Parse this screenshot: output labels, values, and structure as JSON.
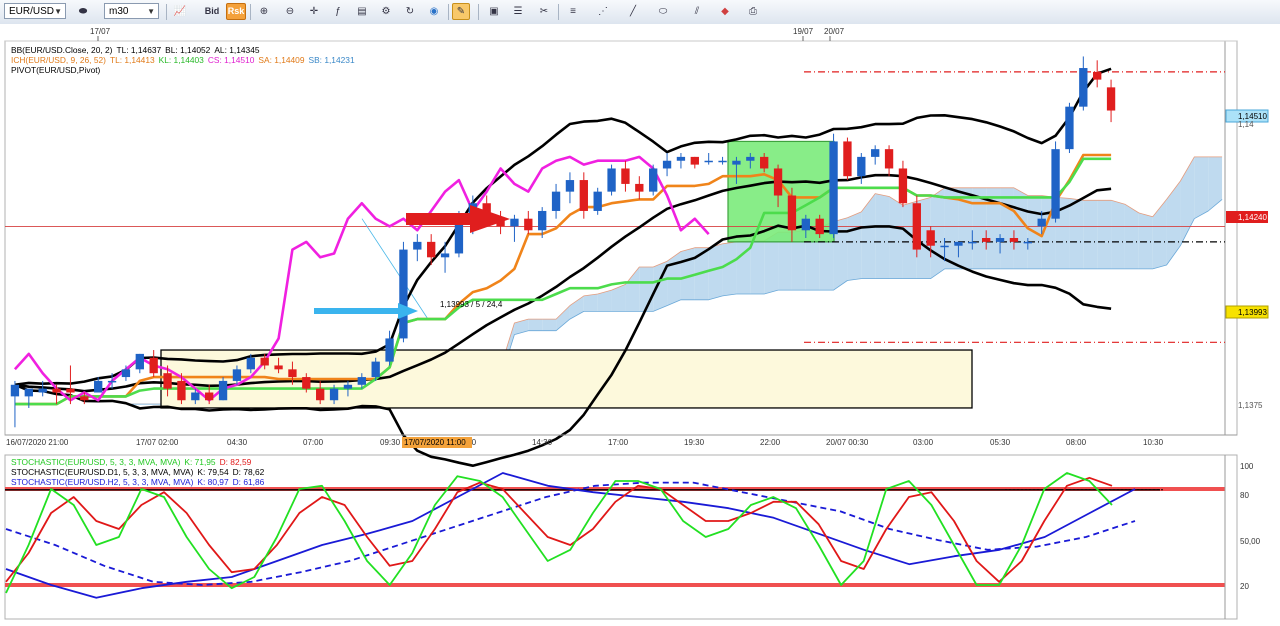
{
  "toolbar": {
    "symbol": "EUR/USD",
    "timeframe": "m30",
    "bid_label": "Bid",
    "risk_label": "Rsk",
    "icons": [
      "chart-type-icon",
      "zoom-in-icon",
      "zoom-out-icon",
      "crosshair-icon",
      "indicators-icon",
      "templates-icon",
      "settings-icon",
      "globe-icon",
      "pencil-tool-icon",
      "image-icon",
      "properties-icon",
      "fibonacci-icon",
      "lines-menu-icon",
      "trend-tools-icon",
      "line-icon",
      "shapes-icon",
      "channels-icon",
      "eraser-icon",
      "print-icon"
    ]
  },
  "colors": {
    "bull": "#1f63c6",
    "bear": "#e01e1e",
    "bb": "#000000",
    "tenkan": "#f0841a",
    "kijun": "#4cdc4c",
    "chikou": "#f020e0",
    "kumo_a": "#f0c8b4",
    "kumo_b": "#b4d4ec",
    "stoch_k": "#22e022",
    "stoch_d": "#e01818",
    "stoch_h2": "#1a1ad6",
    "level": "#f05050"
  },
  "top_dates": [
    "17/07",
    "19/07",
    "20/07"
  ],
  "legends": {
    "bb": {
      "name": "BB(EUR/USD.Close, 20, 2)",
      "tl": "TL: 1,14637",
      "bl": "BL: 1,14052",
      "al": "AL: 1,14345"
    },
    "ich": {
      "name": "ICH(EUR/USD, 9, 26, 52)",
      "tl": "TL: 1,14413",
      "kl": "KL: 1,14403",
      "cs": "CS: 1,14510",
      "sa": "SA: 1,14409",
      "sb": "SB: 1,14231"
    },
    "pivot": "PIVOT(EUR/USD,Pivot)"
  },
  "price_labels": {
    "last": "1,14510",
    "pivot_level": "1,14240",
    "marker": "1,13993",
    "tick_upper": "1,14",
    "tick_lower": "1,1375"
  },
  "annotation": "1,13993 / 5 / 24,4",
  "time_axis": [
    "16/07/2020 21:00",
    "17/07 02:00",
    "04:30",
    "07:00",
    "09:30",
    "12:00",
    "14:30",
    "17:00",
    "19:30",
    "22:00",
    "20/07 00:30",
    "03:00",
    "05:30",
    "08:00",
    "10:30"
  ],
  "crosshair_time": "17/07/2020 11:00",
  "stoch_legends": {
    "m30": {
      "name": "STOCHASTIC(EUR/USD, 5, 3, 3, MVA, MVA)",
      "k": "K: 71,95",
      "d": "D: 82,59"
    },
    "d1": {
      "name": "STOCHASTIC(EUR/USD.D1, 5, 3, 3, MVA, MVA)",
      "k": "K: 79,54",
      "d": "D: 78,62"
    },
    "h2": {
      "name": "STOCHASTIC(EUR/USD.H2, 5, 3, 3, MVA, MVA)",
      "k": "K: 80,97",
      "d": "D: 61,86"
    }
  },
  "stoch_axis": [
    "100",
    "80",
    "50,00",
    "20"
  ],
  "chart_data": {
    "type": "candlestick",
    "symbol": "EUR/USD",
    "timeframe": "m30",
    "ylim": [
      1.137,
      1.1472
    ],
    "candles": [
      {
        "o": 1.138,
        "h": 1.1384,
        "l": 1.1372,
        "c": 1.1383
      },
      {
        "o": 1.138,
        "h": 1.1382,
        "l": 1.1377,
        "c": 1.1382
      },
      {
        "o": 1.1381,
        "h": 1.1384,
        "l": 1.138,
        "c": 1.1382
      },
      {
        "o": 1.1382,
        "h": 1.1383,
        "l": 1.1378,
        "c": 1.1381
      },
      {
        "o": 1.1382,
        "h": 1.1388,
        "l": 1.1378,
        "c": 1.1381
      },
      {
        "o": 1.138,
        "h": 1.1381,
        "l": 1.1378,
        "c": 1.1379
      },
      {
        "o": 1.1381,
        "h": 1.1385,
        "l": 1.1381,
        "c": 1.1384
      },
      {
        "o": 1.1384,
        "h": 1.1386,
        "l": 1.1382,
        "c": 1.1384
      },
      {
        "o": 1.1385,
        "h": 1.1388,
        "l": 1.1384,
        "c": 1.1387
      },
      {
        "o": 1.1387,
        "h": 1.1391,
        "l": 1.1386,
        "c": 1.1391
      },
      {
        "o": 1.139,
        "h": 1.1392,
        "l": 1.1385,
        "c": 1.1386
      },
      {
        "o": 1.1386,
        "h": 1.1388,
        "l": 1.138,
        "c": 1.1382
      },
      {
        "o": 1.1384,
        "h": 1.1386,
        "l": 1.1378,
        "c": 1.1379
      },
      {
        "o": 1.1379,
        "h": 1.1382,
        "l": 1.1378,
        "c": 1.1381
      },
      {
        "o": 1.1381,
        "h": 1.1383,
        "l": 1.1378,
        "c": 1.1379
      },
      {
        "o": 1.1379,
        "h": 1.1385,
        "l": 1.1379,
        "c": 1.1384
      },
      {
        "o": 1.1384,
        "h": 1.1388,
        "l": 1.1383,
        "c": 1.1387
      },
      {
        "o": 1.1387,
        "h": 1.1391,
        "l": 1.1386,
        "c": 1.139
      },
      {
        "o": 1.139,
        "h": 1.1391,
        "l": 1.1387,
        "c": 1.1388
      },
      {
        "o": 1.1388,
        "h": 1.139,
        "l": 1.1386,
        "c": 1.1387
      },
      {
        "o": 1.1387,
        "h": 1.1389,
        "l": 1.1383,
        "c": 1.1385
      },
      {
        "o": 1.1385,
        "h": 1.1386,
        "l": 1.1381,
        "c": 1.1382
      },
      {
        "o": 1.1382,
        "h": 1.1384,
        "l": 1.1378,
        "c": 1.1379
      },
      {
        "o": 1.1379,
        "h": 1.1383,
        "l": 1.1378,
        "c": 1.1382
      },
      {
        "o": 1.1382,
        "h": 1.1384,
        "l": 1.138,
        "c": 1.1383
      },
      {
        "o": 1.1383,
        "h": 1.1386,
        "l": 1.1382,
        "c": 1.1385
      },
      {
        "o": 1.1385,
        "h": 1.139,
        "l": 1.1384,
        "c": 1.1389
      },
      {
        "o": 1.1389,
        "h": 1.1397,
        "l": 1.1388,
        "c": 1.1395
      },
      {
        "o": 1.1395,
        "h": 1.142,
        "l": 1.1394,
        "c": 1.1418
      },
      {
        "o": 1.1418,
        "h": 1.1422,
        "l": 1.1415,
        "c": 1.142
      },
      {
        "o": 1.142,
        "h": 1.1422,
        "l": 1.1414,
        "c": 1.1416
      },
      {
        "o": 1.1416,
        "h": 1.142,
        "l": 1.1412,
        "c": 1.1417
      },
      {
        "o": 1.1417,
        "h": 1.1428,
        "l": 1.1416,
        "c": 1.1426
      },
      {
        "o": 1.1426,
        "h": 1.1432,
        "l": 1.1422,
        "c": 1.143
      },
      {
        "o": 1.143,
        "h": 1.1432,
        "l": 1.1425,
        "c": 1.1426
      },
      {
        "o": 1.1426,
        "h": 1.1428,
        "l": 1.1422,
        "c": 1.1424
      },
      {
        "o": 1.1424,
        "h": 1.1427,
        "l": 1.142,
        "c": 1.1426
      },
      {
        "o": 1.1426,
        "h": 1.1428,
        "l": 1.1422,
        "c": 1.1423
      },
      {
        "o": 1.1423,
        "h": 1.1429,
        "l": 1.1421,
        "c": 1.1428
      },
      {
        "o": 1.1428,
        "h": 1.1435,
        "l": 1.1426,
        "c": 1.1433
      },
      {
        "o": 1.1433,
        "h": 1.1438,
        "l": 1.143,
        "c": 1.1436
      },
      {
        "o": 1.1436,
        "h": 1.1438,
        "l": 1.1426,
        "c": 1.1428
      },
      {
        "o": 1.1428,
        "h": 1.1434,
        "l": 1.1427,
        "c": 1.1433
      },
      {
        "o": 1.1433,
        "h": 1.144,
        "l": 1.1432,
        "c": 1.1439
      },
      {
        "o": 1.1439,
        "h": 1.1441,
        "l": 1.1433,
        "c": 1.1435
      },
      {
        "o": 1.1435,
        "h": 1.1437,
        "l": 1.1431,
        "c": 1.1433
      },
      {
        "o": 1.1433,
        "h": 1.144,
        "l": 1.1432,
        "c": 1.1439
      },
      {
        "o": 1.1439,
        "h": 1.1443,
        "l": 1.1437,
        "c": 1.1441
      },
      {
        "o": 1.1441,
        "h": 1.1443,
        "l": 1.1439,
        "c": 1.1442
      },
      {
        "o": 1.1442,
        "h": 1.1442,
        "l": 1.1439,
        "c": 1.144
      },
      {
        "o": 1.1441,
        "h": 1.1443,
        "l": 1.144,
        "c": 1.1441
      },
      {
        "o": 1.1441,
        "h": 1.1442,
        "l": 1.144,
        "c": 1.1441
      },
      {
        "o": 1.144,
        "h": 1.1442,
        "l": 1.1435,
        "c": 1.1441
      },
      {
        "o": 1.1441,
        "h": 1.1443,
        "l": 1.1439,
        "c": 1.1442
      },
      {
        "o": 1.1442,
        "h": 1.1443,
        "l": 1.1438,
        "c": 1.1439
      },
      {
        "o": 1.1439,
        "h": 1.144,
        "l": 1.1429,
        "c": 1.1432
      },
      {
        "o": 1.1432,
        "h": 1.1434,
        "l": 1.142,
        "c": 1.1423
      },
      {
        "o": 1.1423,
        "h": 1.1427,
        "l": 1.1421,
        "c": 1.1426
      },
      {
        "o": 1.1426,
        "h": 1.1427,
        "l": 1.1421,
        "c": 1.1422
      },
      {
        "o": 1.1422,
        "h": 1.1448,
        "l": 1.1421,
        "c": 1.1446
      },
      {
        "o": 1.1446,
        "h": 1.1447,
        "l": 1.1436,
        "c": 1.1437
      },
      {
        "o": 1.1437,
        "h": 1.1443,
        "l": 1.1435,
        "c": 1.1442
      },
      {
        "o": 1.1442,
        "h": 1.1445,
        "l": 1.144,
        "c": 1.1444
      },
      {
        "o": 1.1444,
        "h": 1.1445,
        "l": 1.1437,
        "c": 1.1439
      },
      {
        "o": 1.1439,
        "h": 1.1441,
        "l": 1.1429,
        "c": 1.143
      },
      {
        "o": 1.143,
        "h": 1.1432,
        "l": 1.1416,
        "c": 1.1418
      },
      {
        "o": 1.1423,
        "h": 1.1424,
        "l": 1.1416,
        "c": 1.1419
      },
      {
        "o": 1.1419,
        "h": 1.1421,
        "l": 1.1415,
        "c": 1.1419
      },
      {
        "o": 1.1419,
        "h": 1.142,
        "l": 1.1416,
        "c": 1.142
      },
      {
        "o": 1.142,
        "h": 1.1423,
        "l": 1.1418,
        "c": 1.142
      },
      {
        "o": 1.1421,
        "h": 1.1423,
        "l": 1.1418,
        "c": 1.142
      },
      {
        "o": 1.142,
        "h": 1.1422,
        "l": 1.1417,
        "c": 1.1421
      },
      {
        "o": 1.1421,
        "h": 1.1423,
        "l": 1.1418,
        "c": 1.142
      },
      {
        "o": 1.142,
        "h": 1.1421,
        "l": 1.1418,
        "c": 1.142
      },
      {
        "o": 1.1424,
        "h": 1.1428,
        "l": 1.1422,
        "c": 1.1426
      },
      {
        "o": 1.1426,
        "h": 1.1446,
        "l": 1.1425,
        "c": 1.1444
      },
      {
        "o": 1.1444,
        "h": 1.1456,
        "l": 1.1443,
        "c": 1.1455
      },
      {
        "o": 1.1455,
        "h": 1.1468,
        "l": 1.1454,
        "c": 1.1465
      },
      {
        "o": 1.1464,
        "h": 1.1467,
        "l": 1.146,
        "c": 1.1462
      },
      {
        "o": 1.146,
        "h": 1.1462,
        "l": 1.1451,
        "c": 1.1454
      }
    ],
    "stochastic": {
      "ylim": [
        0,
        100
      ],
      "levels": [
        80,
        20
      ],
      "series": [
        {
          "name": "STOCHASTIC(EUR/USD, 5, 3, 3, MVA, MVA) K",
          "values": [
            15,
            45,
            80,
            70,
            45,
            50,
            80,
            75,
            50,
            30,
            18,
            25,
            50,
            80,
            82,
            60,
            35,
            20,
            40,
            70,
            88,
            85,
            75,
            55,
            35,
            42,
            65,
            85,
            85,
            80,
            60,
            50,
            55,
            70,
            75,
            68,
            45,
            20,
            35,
            80,
            85,
            70,
            45,
            20,
            20,
            45,
            80,
            90,
            85,
            70
          ]
        },
        {
          "name": "STOCHASTIC(EUR/USD, 5, 3, 3, MVA, MVA) D",
          "values": [
            22,
            40,
            65,
            75,
            60,
            55,
            70,
            78,
            65,
            45,
            28,
            30,
            45,
            65,
            75,
            70,
            50,
            32,
            35,
            55,
            78,
            84,
            80,
            65,
            50,
            45,
            55,
            72,
            82,
            80,
            70,
            60,
            60,
            65,
            72,
            72,
            58,
            35,
            30,
            55,
            75,
            78,
            60,
            35,
            22,
            35,
            60,
            82,
            87,
            82
          ]
        },
        {
          "name": "STOCHASTIC(EUR/USD.D1, 5, 3, 3, MVA, MVA)",
          "values": [
            79.5,
            79.5,
            79.5,
            79.5,
            79.5,
            79.5,
            79.5,
            79.5,
            79.5,
            79.5
          ]
        },
        {
          "name": "STOCHASTIC(EUR/USD.H2, 5, 3, 3, MVA, MVA) K",
          "values": [
            30,
            20,
            12,
            18,
            22,
            25,
            35,
            45,
            52,
            60,
            75,
            90,
            82,
            78,
            75,
            72,
            68,
            62,
            52,
            42,
            33,
            38,
            42,
            50,
            65,
            80
          ]
        },
        {
          "name": "STOCHASTIC(EUR/USD.H2, 5, 3, 3, MVA, MVA) D",
          "values": [
            55,
            45,
            32,
            22,
            20,
            22,
            28,
            35,
            45,
            55,
            65,
            75,
            82,
            84,
            84,
            78,
            72,
            66,
            55,
            48,
            42,
            44,
            50,
            60
          ]
        }
      ]
    }
  }
}
